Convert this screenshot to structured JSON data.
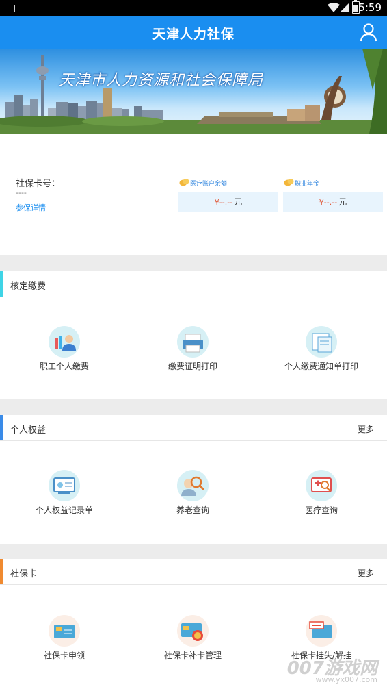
{
  "status": {
    "time": "5:59"
  },
  "app": {
    "title": "天津人力社保",
    "user_icon": "person-icon"
  },
  "banner": {
    "text": "天津市人力资源和社会保障局"
  },
  "account": {
    "card_label": "社保卡号：",
    "card_value": "----",
    "detail_link": "参保详情",
    "medical": {
      "label": "医疗账户余额",
      "amount": "¥--.--",
      "unit": "元"
    },
    "annuity": {
      "label": "职业年金",
      "amount": "¥--.--",
      "unit": "元"
    }
  },
  "sections": [
    {
      "title": "核定缴费",
      "accent": "#3fd4e6",
      "more": "",
      "items": [
        {
          "label": "职工个人缴费",
          "icon": "payment-person-icon"
        },
        {
          "label": "缴费证明打印",
          "icon": "printer-icon"
        },
        {
          "label": "个人缴费通知单打印",
          "icon": "notice-print-icon"
        }
      ]
    },
    {
      "title": "个人权益",
      "accent": "#3a8be8",
      "more": "更多",
      "items": [
        {
          "label": "个人权益记录单",
          "icon": "rights-record-icon"
        },
        {
          "label": "养老查询",
          "icon": "pension-search-icon"
        },
        {
          "label": "医疗查询",
          "icon": "medical-search-icon"
        }
      ]
    },
    {
      "title": "社保卡",
      "accent": "#f08a30",
      "more": "更多",
      "items": [
        {
          "label": "社保卡申领",
          "icon": "card-apply-icon"
        },
        {
          "label": "社保卡补卡管理",
          "icon": "card-replace-icon"
        },
        {
          "label": "社保卡挂失/解挂",
          "icon": "card-lost-icon"
        }
      ]
    }
  ],
  "watermark": {
    "brand": "007游戏网",
    "url": "www.yx007.com"
  }
}
